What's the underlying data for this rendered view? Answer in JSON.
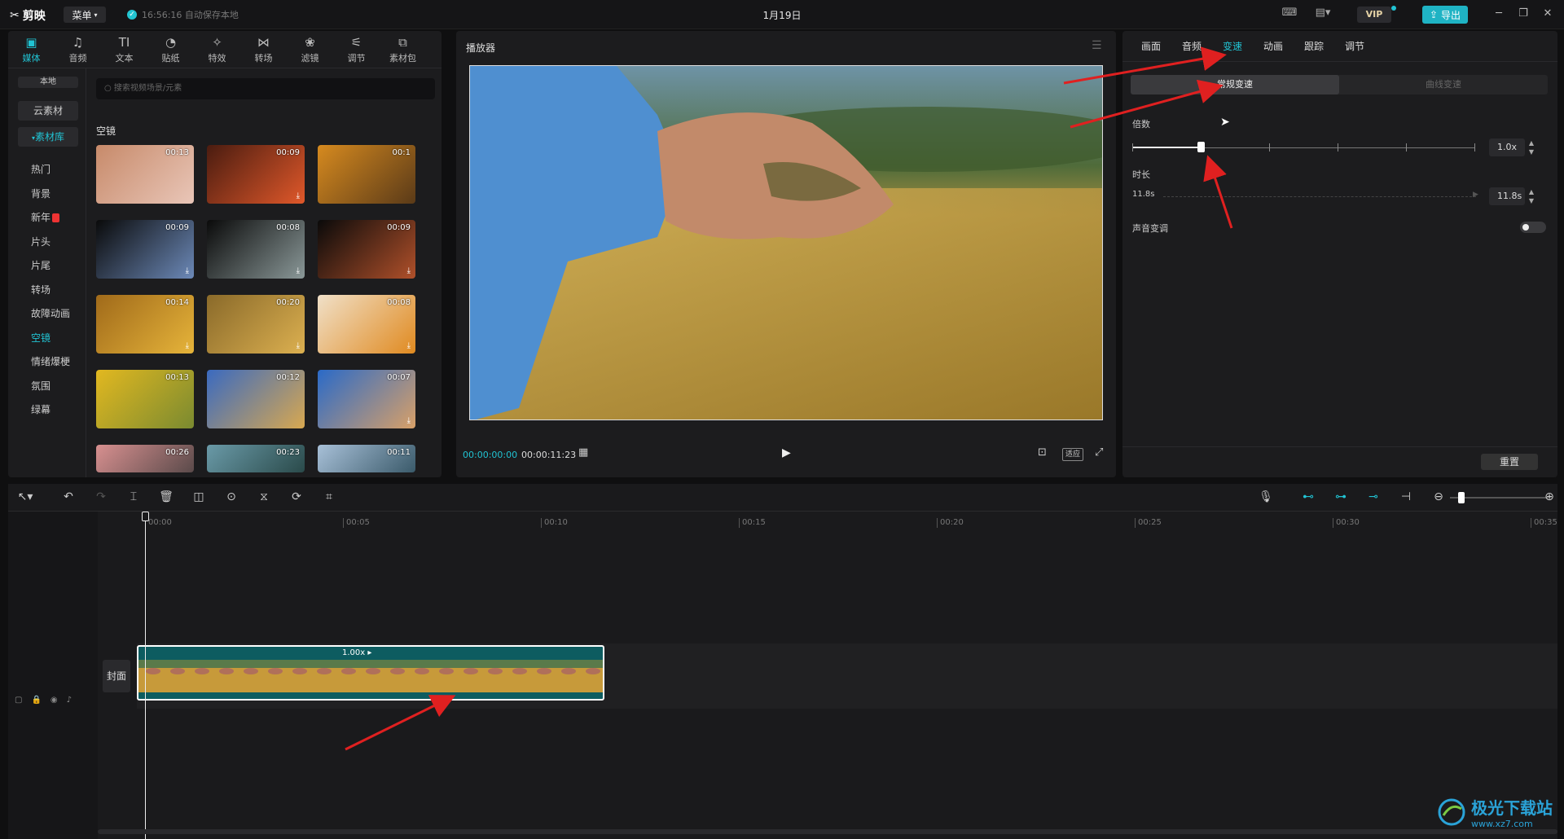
{
  "app": {
    "logo": "剪映",
    "menu": "菜单",
    "save_status": "16:56:16 自动保存本地",
    "title": "1月19日",
    "vip": "VIP",
    "export": "导出"
  },
  "media": {
    "tabs": [
      {
        "label": "媒体",
        "icon": "media-icon"
      },
      {
        "label": "音频",
        "icon": "audio-icon"
      },
      {
        "label": "文本",
        "icon": "text-icon"
      },
      {
        "label": "贴纸",
        "icon": "sticker-icon"
      },
      {
        "label": "特效",
        "icon": "effects-icon"
      },
      {
        "label": "转场",
        "icon": "transition-icon"
      },
      {
        "label": "滤镜",
        "icon": "filter-icon"
      },
      {
        "label": "调节",
        "icon": "adjust-icon"
      },
      {
        "label": "素材包",
        "icon": "package-icon"
      }
    ],
    "nav": {
      "local": "本地",
      "cloud": "云素材",
      "library": "素材库",
      "items": [
        "热门",
        "背景",
        "新年",
        "片头",
        "片尾",
        "转场",
        "故障动画",
        "空镜",
        "情绪爆梗",
        "氛围",
        "绿幕"
      ]
    },
    "search_placeholder": "搜索视频场景/元素",
    "section": "空镜",
    "thumbs": [
      {
        "d": "00:13",
        "c1": "#c78a6a",
        "c2": "#e9c6b8",
        "dl": false
      },
      {
        "d": "00:09",
        "c1": "#4a1c10",
        "c2": "#e0582a",
        "dl": true
      },
      {
        "d": "00:1",
        "c1": "#d68a1f",
        "c2": "#5a3a18",
        "dl": false
      },
      {
        "d": "00:09",
        "c1": "#0a0a0a",
        "c2": "#6c89b8",
        "dl": true
      },
      {
        "d": "00:08",
        "c1": "#0a0a0a",
        "c2": "#8a9898",
        "dl": true
      },
      {
        "d": "00:09",
        "c1": "#0a0a0a",
        "c2": "#b0502a",
        "dl": true
      },
      {
        "d": "00:14",
        "c1": "#a06a1a",
        "c2": "#e6b43a",
        "dl": true
      },
      {
        "d": "00:20",
        "c1": "#8a6a2a",
        "c2": "#dcb050",
        "dl": true
      },
      {
        "d": "00:08",
        "c1": "#f0e0c8",
        "c2": "#e08a20",
        "dl": true
      },
      {
        "d": "00:13",
        "c1": "#e2b820",
        "c2": "#7a8a30",
        "dl": false
      },
      {
        "d": "00:12",
        "c1": "#3a6ac0",
        "c2": "#d8a850",
        "dl": false
      },
      {
        "d": "00:07",
        "c1": "#2a6ac8",
        "c2": "#d8a068",
        "dl": true
      },
      {
        "d": "00:26",
        "c1": "#d89090",
        "c2": "#5a4a4a",
        "dl": false
      },
      {
        "d": "00:23",
        "c1": "#6a9aa8",
        "c2": "#2a4a4a",
        "dl": false
      },
      {
        "d": "00:11",
        "c1": "#a8c0d8",
        "c2": "#3a5a6a",
        "dl": false
      }
    ]
  },
  "player": {
    "title": "播放器",
    "current": "00:00:00:00",
    "total": "00:00:11:23",
    "fit": "适应"
  },
  "props": {
    "tabs": [
      "画面",
      "音频",
      "变速",
      "动画",
      "跟踪",
      "调节"
    ],
    "active_tab": "变速",
    "mode_normal": "常规变速",
    "mode_curve": "曲线变速",
    "multiplier_label": "倍数",
    "multiplier_value": "1.0x",
    "multiplier_position": 0.2,
    "duration_label": "时长",
    "duration_from": "11.8s",
    "duration_value": "11.8s",
    "pitch_label": "声音变调",
    "pitch_on": false,
    "reset": "重置"
  },
  "timeline": {
    "ticks": [
      "00:00",
      "00:05",
      "00:10",
      "00:15",
      "00:20",
      "00:25",
      "00:30",
      "00:35"
    ],
    "cover": "封面",
    "clip_speed": "1.00x"
  },
  "watermark": {
    "name": "极光下载站",
    "url": "www.xz7.com"
  }
}
